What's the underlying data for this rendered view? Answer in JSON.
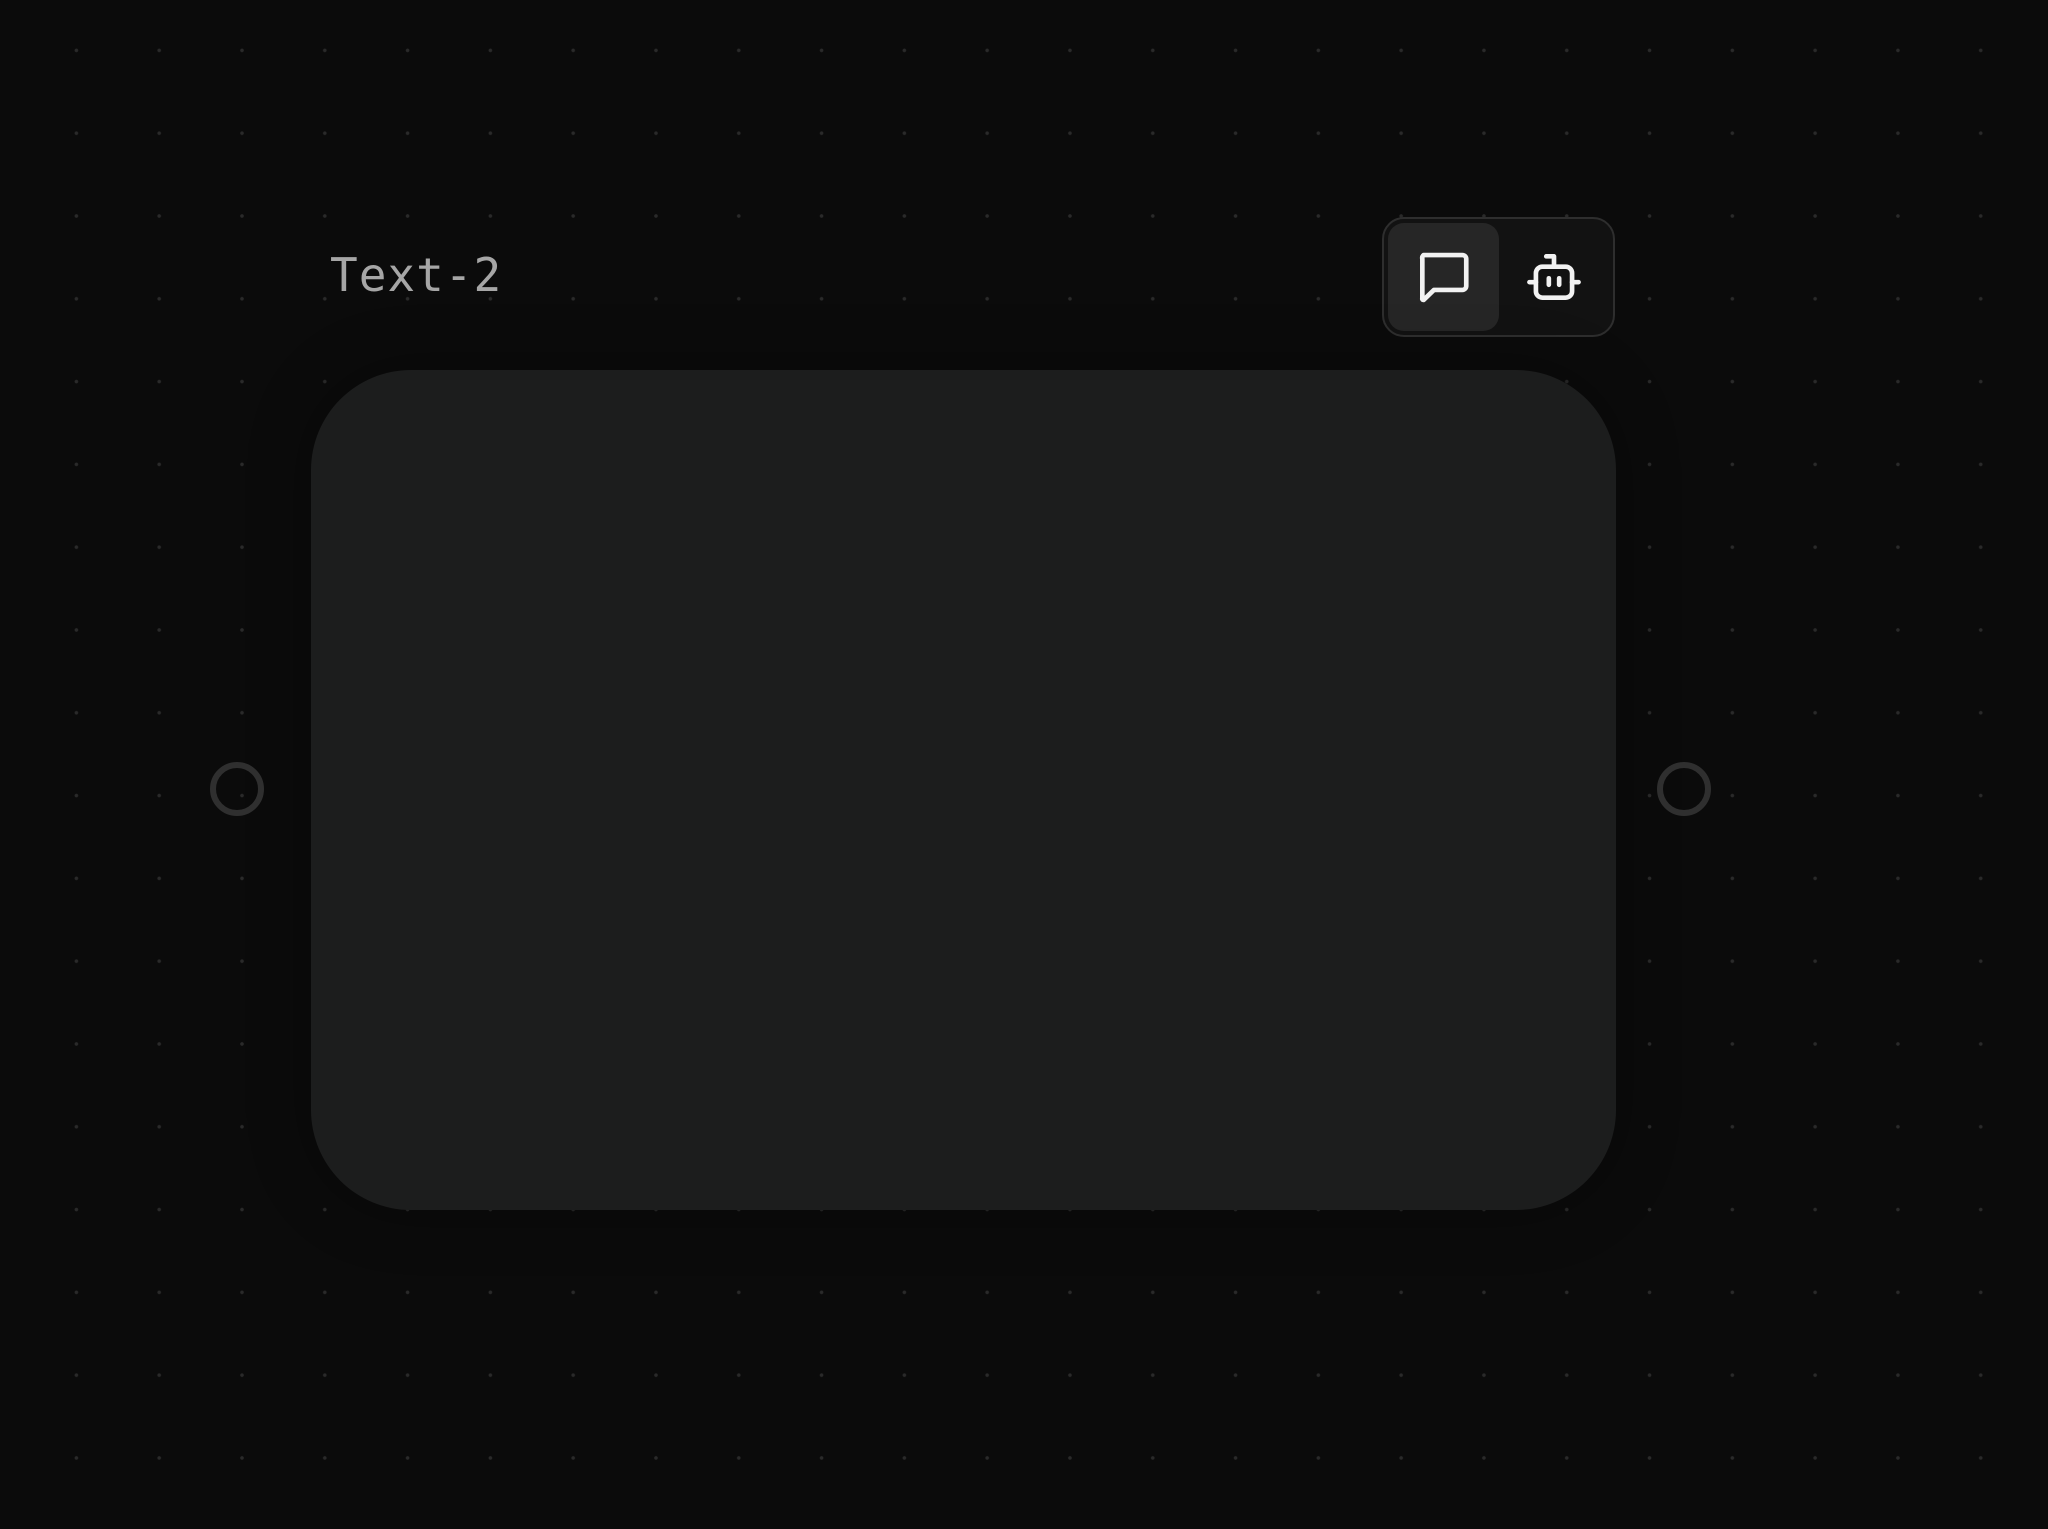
{
  "node": {
    "title": "Text-2"
  },
  "mode_toggle": {
    "options": [
      {
        "icon": "chat-bubble-icon",
        "active": true
      },
      {
        "icon": "robot-icon",
        "active": false
      }
    ]
  },
  "colors": {
    "background": "#0b0b0b",
    "card": "#1c1d1d",
    "title_text": "#a6a6a6",
    "icon": "#f2f2f2",
    "active_option": "#262626"
  }
}
